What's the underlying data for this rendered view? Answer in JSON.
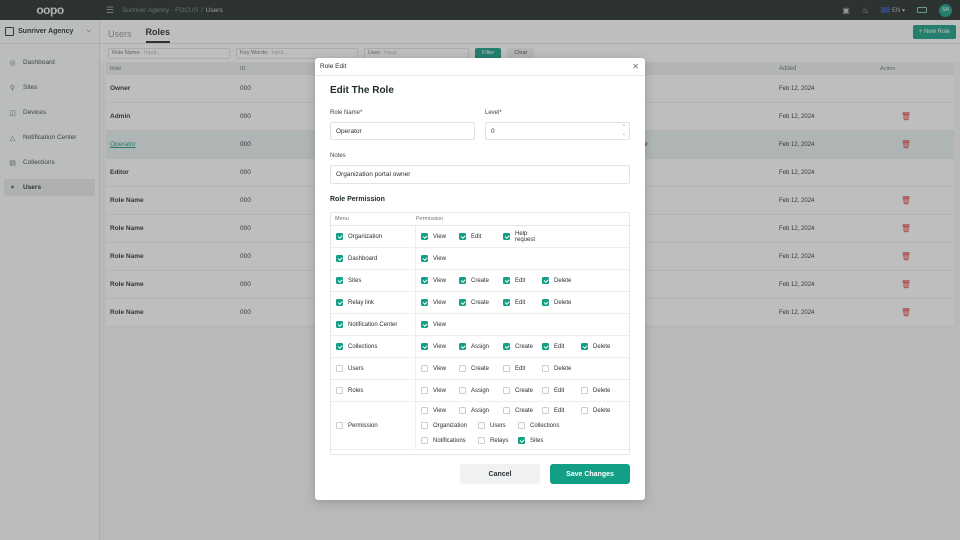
{
  "app": {
    "logo": "oopo",
    "breadcrumb": [
      "Sunriver Agency - FOCUS",
      "/",
      "Users"
    ],
    "lang": "EN",
    "avatar": "SA"
  },
  "sidebar": {
    "org_name": "Sunriver Agency",
    "items": [
      {
        "label": "Dashboard",
        "icon": "globe-icon"
      },
      {
        "label": "Sites",
        "icon": "location-icon"
      },
      {
        "label": "Devices",
        "icon": "device-icon"
      },
      {
        "label": "Notification Center",
        "icon": "warning-icon"
      },
      {
        "label": "Collections",
        "icon": "collection-icon"
      },
      {
        "label": "Users",
        "icon": "user-icon",
        "active": true
      }
    ]
  },
  "tabs": [
    "Users",
    "Roles"
  ],
  "new_role_label": "+ New Role",
  "filters": {
    "role_name_label": "Role Name:",
    "role_name_placeholder": "Input...",
    "keywords_label": "Key Words:",
    "keywords_placeholder": "Input...",
    "user_label": "User:",
    "user_placeholder": "Input",
    "filter_label": "Filter",
    "clear_label": "Clear"
  },
  "table": {
    "headers": {
      "role": "Role",
      "id": "ID",
      "added": "Added",
      "action": "Action"
    },
    "rows": [
      {
        "role": "Owner",
        "id": "000",
        "added": "Feb 12, 2024",
        "delete": false
      },
      {
        "role": "Admin",
        "id": "000",
        "added": "Feb 12, 2024",
        "delete": true
      },
      {
        "role": "Operator",
        "id": "000",
        "extra": "ator",
        "added": "Feb 12, 2024",
        "delete": true,
        "highlight": true
      },
      {
        "role": "Editor",
        "id": "000",
        "added": "Feb 12, 2024",
        "delete": false
      },
      {
        "role": "Role Name",
        "id": "000",
        "added": "Feb 12, 2024",
        "delete": true
      },
      {
        "role": "Role Name",
        "id": "000",
        "added": "Feb 12, 2024",
        "delete": true
      },
      {
        "role": "Role Name",
        "id": "000",
        "added": "Feb 12, 2024",
        "delete": true
      },
      {
        "role": "Role Name",
        "id": "000",
        "added": "Feb 12, 2024",
        "delete": true
      },
      {
        "role": "Role Name",
        "id": "000",
        "added": "Feb 12, 2024",
        "delete": true
      }
    ]
  },
  "modal": {
    "header": "Role Edit",
    "title": "Edit The Role",
    "role_name_label": "Role Name*",
    "role_name_value": "Operator",
    "level_label": "Level*",
    "level_value": "0",
    "notes_label": "Notes",
    "notes_value": "Organization portal owner",
    "section_title": "Role Permission",
    "col_menu": "Menu",
    "col_permission": "Permission",
    "permissions": [
      {
        "menu": "Organization",
        "checked": true,
        "lines": [
          [
            [
              "View",
              true
            ],
            [
              "Edit",
              true
            ],
            [
              "Help request",
              true
            ]
          ]
        ]
      },
      {
        "menu": "Dashboard",
        "checked": true,
        "lines": [
          [
            [
              "View",
              true
            ]
          ]
        ]
      },
      {
        "menu": "Sites",
        "checked": true,
        "lines": [
          [
            [
              "View",
              true
            ],
            [
              "Create",
              true
            ],
            [
              "Edit",
              true
            ],
            [
              "Delete",
              true
            ]
          ]
        ]
      },
      {
        "menu": "Relay link",
        "checked": true,
        "lines": [
          [
            [
              "View",
              true
            ],
            [
              "Create",
              true
            ],
            [
              "Edit",
              true
            ],
            [
              "Delete",
              true
            ]
          ]
        ]
      },
      {
        "menu": "Notification Center",
        "checked": true,
        "lines": [
          [
            [
              "View",
              true
            ]
          ]
        ]
      },
      {
        "menu": "Collections",
        "checked": true,
        "lines": [
          [
            [
              "View",
              true
            ],
            [
              "Assign",
              true
            ],
            [
              "Create",
              true
            ],
            [
              "Edit",
              true
            ],
            [
              "Delete",
              true
            ]
          ]
        ]
      },
      {
        "menu": "Users",
        "checked": false,
        "lines": [
          [
            [
              "View",
              false
            ],
            [
              "Create",
              false
            ],
            [
              "Edit",
              false
            ],
            [
              "Delete",
              false
            ]
          ]
        ]
      },
      {
        "menu": "Roles",
        "checked": false,
        "lines": [
          [
            [
              "View",
              false
            ],
            [
              "Assign",
              false
            ],
            [
              "Create",
              false
            ],
            [
              "Edit",
              false
            ],
            [
              "Delete",
              false
            ]
          ]
        ]
      },
      {
        "menu": "Permission",
        "checked": false,
        "lines": [
          [
            [
              "View",
              false
            ],
            [
              "Assign",
              false
            ],
            [
              "Create",
              false
            ],
            [
              "Edit",
              false
            ],
            [
              "Delete",
              false
            ]
          ],
          [
            [
              "Organization",
              false
            ],
            [
              "Users",
              false
            ],
            [
              "Collections",
              false
            ]
          ],
          [
            [
              "Notifications",
              false
            ],
            [
              "Relays",
              false
            ],
            [
              "Sites",
              true
            ]
          ]
        ]
      }
    ],
    "cancel_label": "Cancel",
    "save_label": "Save Changes"
  }
}
